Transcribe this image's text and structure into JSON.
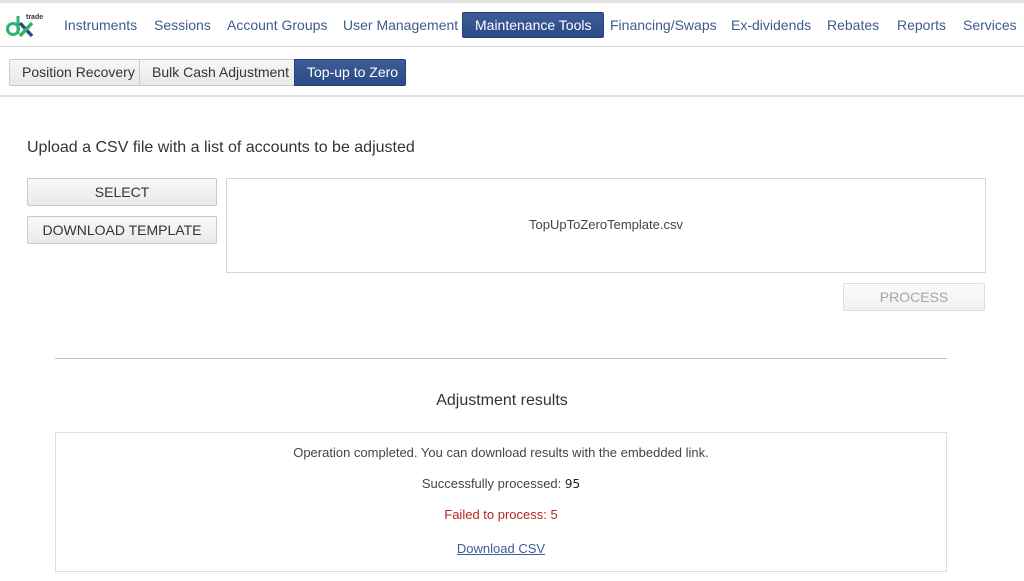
{
  "brand": {
    "logo_text": "trade",
    "logo_mark": "dx"
  },
  "nav": {
    "items": [
      {
        "label": "Instruments",
        "active": false
      },
      {
        "label": "Sessions",
        "active": false
      },
      {
        "label": "Account Groups",
        "active": false
      },
      {
        "label": "User Management",
        "active": false
      },
      {
        "label": "Maintenance Tools",
        "active": true
      },
      {
        "label": "Financing/Swaps",
        "active": false
      },
      {
        "label": "Ex-dividends",
        "active": false
      },
      {
        "label": "Rebates",
        "active": false
      },
      {
        "label": "Reports",
        "active": false
      },
      {
        "label": "Services",
        "active": false
      }
    ]
  },
  "subnav": {
    "tabs": [
      {
        "label": "Position Recovery",
        "active": false
      },
      {
        "label": "Bulk Cash Adjustment",
        "active": false
      },
      {
        "label": "Top-up to Zero",
        "active": true
      }
    ]
  },
  "upload": {
    "title": "Upload a CSV file with a list of accounts to be adjusted",
    "select_label": "SELECT",
    "download_template_label": "DOWNLOAD TEMPLATE",
    "selected_file": "TopUpToZeroTemplate.csv",
    "process_label": "PROCESS",
    "process_enabled": false
  },
  "results": {
    "title": "Adjustment results",
    "message": "Operation completed. You can download results with the embedded link.",
    "success_label": "Successfully processed:",
    "success_count": "95",
    "failed_label": "Failed to process:",
    "failed_count": "5",
    "download_link": "Download CSV"
  },
  "colors": {
    "nav_text": "#3f5b8f",
    "active_bg": "#2f4e8a",
    "error_text": "#b3261e",
    "link": "#3f5b9a"
  }
}
